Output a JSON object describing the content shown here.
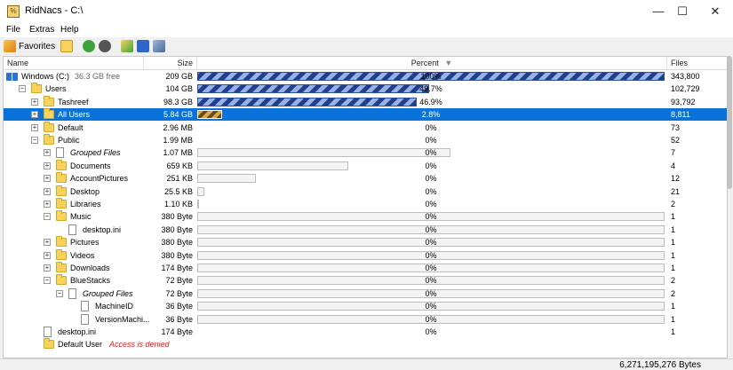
{
  "window": {
    "title": "RidNacs - C:\\",
    "icon_text": "%",
    "min_label": "—",
    "max_label": "☐",
    "close_label": "✕"
  },
  "menu": [
    "File",
    "Extras",
    "Help"
  ],
  "toolbar": {
    "favorites_label": "Favorites"
  },
  "columns": {
    "name": "Name",
    "size": "Size",
    "percent": "Percent",
    "files": "Files",
    "sort_indicator": "▼"
  },
  "rows": [
    {
      "name": "Windows (C:)",
      "extra": "36.3 GB free",
      "size": "209 GB",
      "percent_text": "100%",
      "percent": 100,
      "files": "343,800",
      "level": 0,
      "icon": "drive",
      "expander": "none"
    },
    {
      "name": "Users",
      "size": "104 GB",
      "percent_text": "49.7%",
      "percent": 49.7,
      "files": "102,729",
      "level": 1,
      "icon": "folder",
      "expander": "minus"
    },
    {
      "name": "Tashreef",
      "size": "98.3 GB",
      "percent_text": "46.9%",
      "percent": 46.9,
      "files": "93,792",
      "level": 2,
      "icon": "folder",
      "expander": "plus"
    },
    {
      "name": "All Users",
      "size": "5.84 GB",
      "percent_text": "2.8%",
      "percent": 2.8,
      "files": "8,811",
      "level": 2,
      "icon": "folder",
      "expander": "plus",
      "selected": true
    },
    {
      "name": "Default",
      "size": "2.96 MB",
      "percent_text": "0%",
      "percent": 0,
      "files": "73",
      "level": 2,
      "icon": "folder",
      "expander": "plus"
    },
    {
      "name": "Public",
      "size": "1.99 MB",
      "percent_text": "0%",
      "percent": 0,
      "files": "52",
      "level": 2,
      "icon": "folder",
      "expander": "minus"
    },
    {
      "name": "Grouped Files",
      "size": "1.07 MB",
      "percent_text": "0%",
      "percent": 0,
      "files": "7",
      "level": 3,
      "icon": "grouped",
      "expander": "plus",
      "italic": true
    },
    {
      "name": "Documents",
      "size": "659 KB",
      "percent_text": "0%",
      "percent": 0,
      "files": "4",
      "level": 3,
      "icon": "folder",
      "expander": "plus"
    },
    {
      "name": "AccountPictures",
      "size": "251 KB",
      "percent_text": "0%",
      "percent": 0,
      "files": "12",
      "level": 3,
      "icon": "folder",
      "expander": "plus"
    },
    {
      "name": "Desktop",
      "size": "25.5 KB",
      "percent_text": "0%",
      "percent": 0,
      "files": "21",
      "level": 3,
      "icon": "folder",
      "expander": "plus"
    },
    {
      "name": "Libraries",
      "size": "1.10 KB",
      "percent_text": "0%",
      "percent": 0,
      "files": "2",
      "level": 3,
      "icon": "folder",
      "expander": "plus"
    },
    {
      "name": "Music",
      "size": "380 Byte",
      "percent_text": "0%",
      "percent": 0,
      "files": "1",
      "level": 3,
      "icon": "folder",
      "expander": "minus"
    },
    {
      "name": "desktop.ini",
      "size": "380 Byte",
      "percent_text": "0%",
      "percent": 0,
      "files": "1",
      "level": 4,
      "icon": "file",
      "expander": "none"
    },
    {
      "name": "Pictures",
      "size": "380 Byte",
      "percent_text": "0%",
      "percent": 0,
      "files": "1",
      "level": 3,
      "icon": "folder",
      "expander": "plus"
    },
    {
      "name": "Videos",
      "size": "380 Byte",
      "percent_text": "0%",
      "percent": 0,
      "files": "1",
      "level": 3,
      "icon": "folder",
      "expander": "plus"
    },
    {
      "name": "Downloads",
      "size": "174 Byte",
      "percent_text": "0%",
      "percent": 0,
      "files": "1",
      "level": 3,
      "icon": "folder",
      "expander": "plus"
    },
    {
      "name": "BlueStacks",
      "size": "72 Byte",
      "percent_text": "0%",
      "percent": 0,
      "files": "2",
      "level": 3,
      "icon": "folder",
      "expander": "minus"
    },
    {
      "name": "Grouped Files",
      "size": "72 Byte",
      "percent_text": "0%",
      "percent": 0,
      "files": "2",
      "level": 4,
      "icon": "grouped",
      "expander": "minus",
      "italic": true
    },
    {
      "name": "MachineID",
      "size": "36 Byte",
      "percent_text": "0%",
      "percent": 0,
      "files": "1",
      "level": 5,
      "icon": "file",
      "expander": "none"
    },
    {
      "name": "VersionMachi...",
      "size": "36 Byte",
      "percent_text": "0%",
      "percent": 0,
      "files": "1",
      "level": 5,
      "icon": "file",
      "expander": "none"
    },
    {
      "name": "desktop.ini",
      "size": "174 Byte",
      "percent_text": "0%",
      "percent": 0,
      "files": "1",
      "level": 2,
      "icon": "file",
      "expander": "none"
    },
    {
      "name": "Default User",
      "denied": "Access is denied",
      "size": "",
      "percent_text": "",
      "percent": 0,
      "files": "",
      "level": 2,
      "icon": "folder",
      "expander": "none"
    }
  ],
  "status": {
    "total_bytes": "6,271,195,276 Bytes"
  }
}
